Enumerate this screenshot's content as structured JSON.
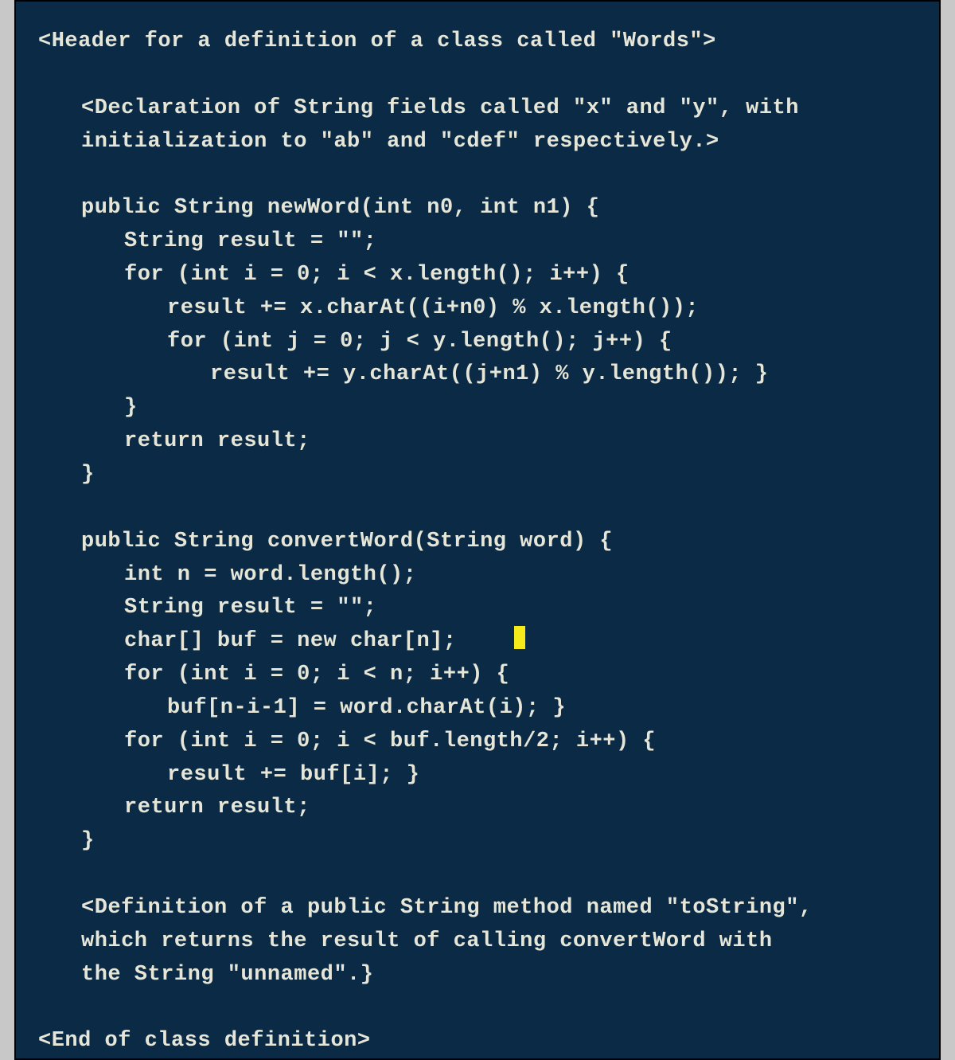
{
  "code": {
    "l01": "<Header for a definition of a class called \"Words\">",
    "l02": "",
    "l03": "<Declaration of String fields called \"x\" and \"y\", with",
    "l04": "initialization to \"ab\" and \"cdef\" respectively.>",
    "l05": "",
    "l06": "public String newWord(int n0, int n1) {",
    "l07": "String result = \"\";",
    "l08": "for (int i = 0; i < x.length(); i++) {",
    "l09": "result += x.charAt((i+n0) % x.length());",
    "l10": "for (int j = 0; j < y.length(); j++) {",
    "l11": "result += y.charAt((j+n1) % y.length()); }",
    "l12": "}",
    "l13": "return result;",
    "l14": "}",
    "l15": "",
    "l16": "public String convertWord(String word) {",
    "l17": "int n = word.length();",
    "l18": "String result = \"\";",
    "l19": "char[] buf = new char[n];",
    "l20": "for (int i = 0; i < n; i++) {",
    "l21": "buf[n-i-1] = word.charAt(i); }",
    "l22": "for (int i = 0; i < buf.length/2; i++) {",
    "l23": "result += buf[i]; }",
    "l24": "return result;",
    "l25": "}",
    "l26": "",
    "l27": "<Definition of a public String method named \"toString\",",
    "l28": "which returns the result of calling convertWord with",
    "l29": "the String \"unnamed\".}",
    "l30": "",
    "l31": "<End of class definition>"
  }
}
